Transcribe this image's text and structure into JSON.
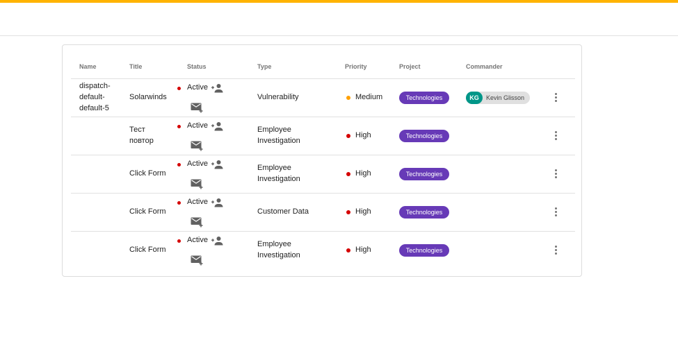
{
  "colors": {
    "top_accent": "#ffb300",
    "project_chip": "#673ab7",
    "avatar": "#009688",
    "status_dot": "#d50000",
    "priority_high": "#d50000",
    "priority_medium": "#ffa000"
  },
  "table": {
    "headers": {
      "name": "Name",
      "title": "Title",
      "status": "Status",
      "type": "Type",
      "priority": "Priority",
      "project": "Project",
      "commander": "Commander"
    },
    "rows": [
      {
        "name": [
          "dispatch-",
          "default-",
          "default-5"
        ],
        "title": [
          "Solarwinds"
        ],
        "status": "Active",
        "type": [
          "Vulnerability"
        ],
        "priority": "Medium",
        "project": "Technologies",
        "commander": {
          "initials": "KG",
          "name": "Kevin Glisson"
        }
      },
      {
        "name": [],
        "title": [
          "Тест",
          "повтор"
        ],
        "status": "Active",
        "type": [
          "Employee",
          "Investigation"
        ],
        "priority": "High",
        "project": "Technologies",
        "commander": null
      },
      {
        "name": [],
        "title": [
          "Click Form"
        ],
        "status": "Active",
        "type": [
          "Employee",
          "Investigation"
        ],
        "priority": "High",
        "project": "Technologies",
        "commander": null
      },
      {
        "name": [],
        "title": [
          "Click Form"
        ],
        "status": "Active",
        "type": [
          "Customer Data"
        ],
        "priority": "High",
        "project": "Technologies",
        "commander": null
      },
      {
        "name": [],
        "title": [
          "Click Form"
        ],
        "status": "Active",
        "type": [
          "Employee",
          "Investigation"
        ],
        "priority": "High",
        "project": "Technologies",
        "commander": null
      }
    ],
    "icons": {
      "add_person": "person-add-icon",
      "mail_add": "mail-add-icon",
      "row_menu": "more-vert-icon"
    }
  }
}
